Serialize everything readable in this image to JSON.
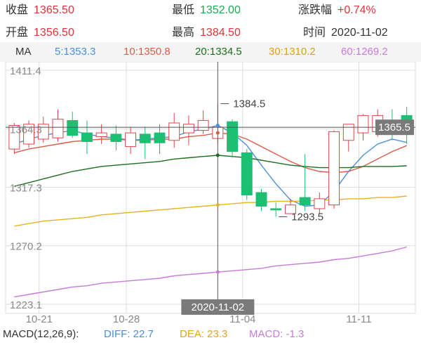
{
  "info": {
    "close": {
      "label": "收盘",
      "value": "1365.50"
    },
    "low": {
      "label": "最低",
      "value": "1352.00"
    },
    "change": {
      "label": "涨跌幅",
      "value": "+0.74%"
    },
    "open": {
      "label": "开盘",
      "value": "1356.50"
    },
    "high": {
      "label": "最高",
      "value": "1384.50"
    },
    "time": {
      "label": "时间",
      "value": "2020-11-02"
    }
  },
  "ma_bar": {
    "label": "MA",
    "ma5": "5:1353.3",
    "ma10": "10:1350.8",
    "ma20": "20:1334.5",
    "ma30": "30:1310.2",
    "ma60": "60:1269.2"
  },
  "macd_bar": {
    "label": "MACD(12,26,9):",
    "diff": "DIFF: 22.7",
    "dea": "DEA: 23.3",
    "macd": "MACD: -1.3"
  },
  "colors": {
    "up": "#e0434a",
    "down": "#1dbf73",
    "ma5": "#4a90d9",
    "ma10": "#d95d4a",
    "ma20": "#1e6e1e",
    "ma30": "#e6b422",
    "ma60": "#c97ad8",
    "grid": "#dddddd",
    "crosshair": "#555555"
  },
  "chart_data": {
    "type": "candlestick",
    "y_tick_labels": [
      "1411.4",
      "1364.3",
      "1317.3",
      "1270.2",
      "1223.1"
    ],
    "x_tick_labels": [
      "10-21",
      "10-28",
      "11-04",
      "11-11"
    ],
    "ylim": [
      1223.1,
      1411.4
    ],
    "crosshair": {
      "date": "2020-11-02",
      "high_label": "1384.5",
      "price_label": "1365.5"
    },
    "low_label": "1293.5",
    "candles": [
      {
        "o": 1348,
        "c": 1367,
        "h": 1369,
        "l": 1344
      },
      {
        "o": 1352,
        "c": 1368,
        "h": 1371,
        "l": 1349
      },
      {
        "o": 1356,
        "c": 1368,
        "h": 1374,
        "l": 1353
      },
      {
        "o": 1357,
        "c": 1372,
        "h": 1380,
        "l": 1354
      },
      {
        "o": 1371,
        "c": 1359,
        "h": 1378,
        "l": 1357
      },
      {
        "o": 1361,
        "c": 1354,
        "h": 1371,
        "l": 1344
      },
      {
        "o": 1358,
        "c": 1361,
        "h": 1368,
        "l": 1352
      },
      {
        "o": 1360,
        "c": 1354,
        "h": 1367,
        "l": 1347
      },
      {
        "o": 1350,
        "c": 1361,
        "h": 1366,
        "l": 1344
      },
      {
        "o": 1360,
        "c": 1353,
        "h": 1366,
        "l": 1340
      },
      {
        "o": 1361,
        "c": 1353,
        "h": 1368,
        "l": 1344
      },
      {
        "o": 1355,
        "c": 1369,
        "h": 1377,
        "l": 1349
      },
      {
        "o": 1361,
        "c": 1368,
        "h": 1375,
        "l": 1351
      },
      {
        "o": 1363,
        "c": 1371,
        "h": 1379,
        "l": 1360
      },
      {
        "o": 1356.5,
        "c": 1365.5,
        "h": 1384.5,
        "l": 1352
      },
      {
        "o": 1370,
        "c": 1346,
        "h": 1372,
        "l": 1341
      },
      {
        "o": 1345,
        "c": 1311,
        "h": 1348,
        "l": 1307
      },
      {
        "o": 1313,
        "c": 1302,
        "h": 1316,
        "l": 1298
      },
      {
        "o": 1300,
        "c": 1299,
        "h": 1305,
        "l": 1293.5
      },
      {
        "o": 1296,
        "c": 1303,
        "h": 1308,
        "l": 1296
      },
      {
        "o": 1309,
        "c": 1303,
        "h": 1344,
        "l": 1298
      },
      {
        "o": 1300,
        "c": 1308,
        "h": 1313,
        "l": 1296
      },
      {
        "o": 1303,
        "c": 1362,
        "h": 1363,
        "l": 1300
      },
      {
        "o": 1355,
        "c": 1368,
        "h": 1368,
        "l": 1346
      },
      {
        "o": 1361,
        "c": 1375,
        "h": 1376,
        "l": 1355
      },
      {
        "o": 1362,
        "c": 1375,
        "h": 1380,
        "l": 1358
      },
      {
        "o": 1362,
        "c": 1360,
        "h": 1380,
        "l": 1355
      },
      {
        "o": 1375,
        "c": 1365.5,
        "h": 1382,
        "l": 1352
      }
    ],
    "series": [
      {
        "name": "MA5",
        "color_key": "ma5",
        "values": [
          1352,
          1356,
          1359,
          1361,
          1363,
          1360,
          1358,
          1357,
          1355,
          1356,
          1357,
          1358,
          1362,
          1364,
          1367,
          1361,
          1351,
          1335,
          1320,
          1307,
          1302,
          1303,
          1314,
          1330,
          1343,
          1352,
          1356,
          1353.3
        ]
      },
      {
        "name": "MA10",
        "color_key": "ma10",
        "values": [
          1345,
          1348,
          1350,
          1352,
          1354,
          1355,
          1356,
          1356,
          1355,
          1355,
          1356,
          1356,
          1358,
          1359,
          1361,
          1360,
          1356,
          1350,
          1344,
          1338,
          1333,
          1330,
          1329,
          1330,
          1334,
          1340,
          1346,
          1350.8
        ]
      },
      {
        "name": "MA20",
        "color_key": "ma20",
        "values": [
          1318,
          1321,
          1324,
          1327,
          1330,
          1332,
          1334,
          1335,
          1336,
          1337,
          1338,
          1340,
          1341,
          1342,
          1343,
          1342,
          1341,
          1339,
          1337,
          1335,
          1334,
          1333,
          1333,
          1333,
          1334,
          1334,
          1334,
          1334.5
        ]
      },
      {
        "name": "MA30",
        "color_key": "ma30",
        "values": [
          1286,
          1288,
          1290,
          1291,
          1292,
          1293,
          1295,
          1296,
          1297,
          1298,
          1299,
          1300,
          1301,
          1302,
          1303,
          1304,
          1305,
          1305,
          1306,
          1306,
          1306,
          1307,
          1307,
          1308,
          1308,
          1309,
          1309,
          1310.2
        ]
      },
      {
        "name": "MA60",
        "color_key": "ma60",
        "values": [
          1229,
          1231,
          1233,
          1235,
          1237,
          1238,
          1240,
          1241,
          1242,
          1243,
          1244,
          1246,
          1247,
          1248,
          1249,
          1250,
          1251,
          1252,
          1254,
          1255,
          1256,
          1257,
          1259,
          1260,
          1262,
          1264,
          1266,
          1269.2
        ]
      }
    ]
  }
}
